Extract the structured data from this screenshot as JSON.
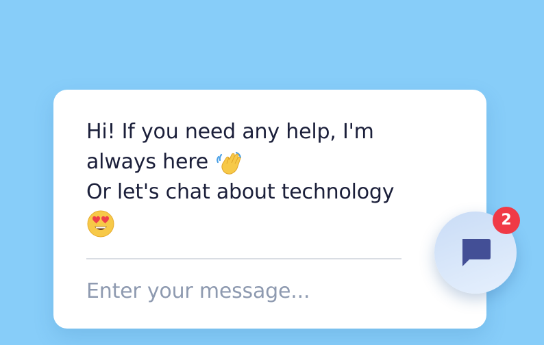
{
  "chat": {
    "greeting_line1": "Hi! If you need any help, I'm",
    "greeting_line2": "always here",
    "greeting_line3": "Or let's chat about technology",
    "wave_emoji": "waving-hand-emoji",
    "love_emoji": "heart-eyes-emoji",
    "input_placeholder": "Enter your message..."
  },
  "launcher": {
    "icon": "chat-bubble-icon",
    "unread_count": "2"
  },
  "colors": {
    "background": "#87cdf9",
    "card": "#ffffff",
    "text": "#1b1f3a",
    "placeholder": "#8e9ab0",
    "badge": "#f03a46",
    "chat_icon": "#434f96"
  }
}
